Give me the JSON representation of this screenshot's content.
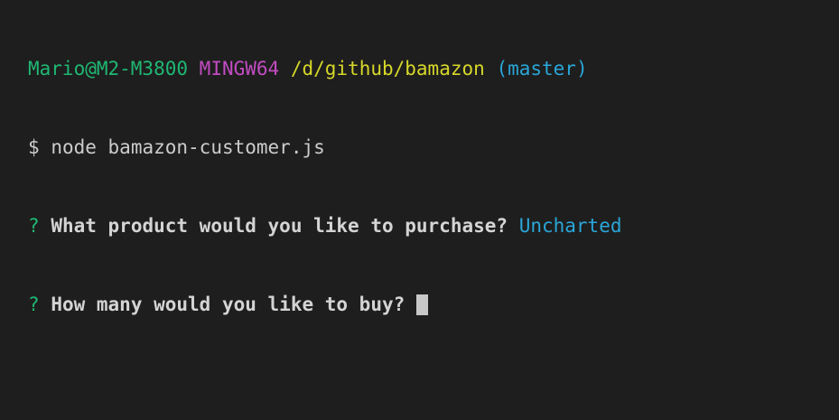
{
  "prompt": {
    "user_host": "Mario@M2-M3800",
    "system": "MINGW64",
    "cwd": "/d/github/bamazon",
    "branch": "(master)"
  },
  "command": {
    "symbol": "$",
    "text": "node bamazon-customer.js"
  },
  "questions": [
    {
      "marker": "?",
      "text": "What product would you like to purchase?",
      "answer": "Uncharted"
    },
    {
      "marker": "?",
      "text": "How many would you like to buy?",
      "answer": ""
    }
  ],
  "colors": {
    "background": "#1e1e1e",
    "user_host": "#1fb873",
    "system": "#c24bc2",
    "cwd": "#d7d72a",
    "branch": "#2aa6d8",
    "answer": "#2aa6d8",
    "cursor": "#c8c8c8"
  }
}
